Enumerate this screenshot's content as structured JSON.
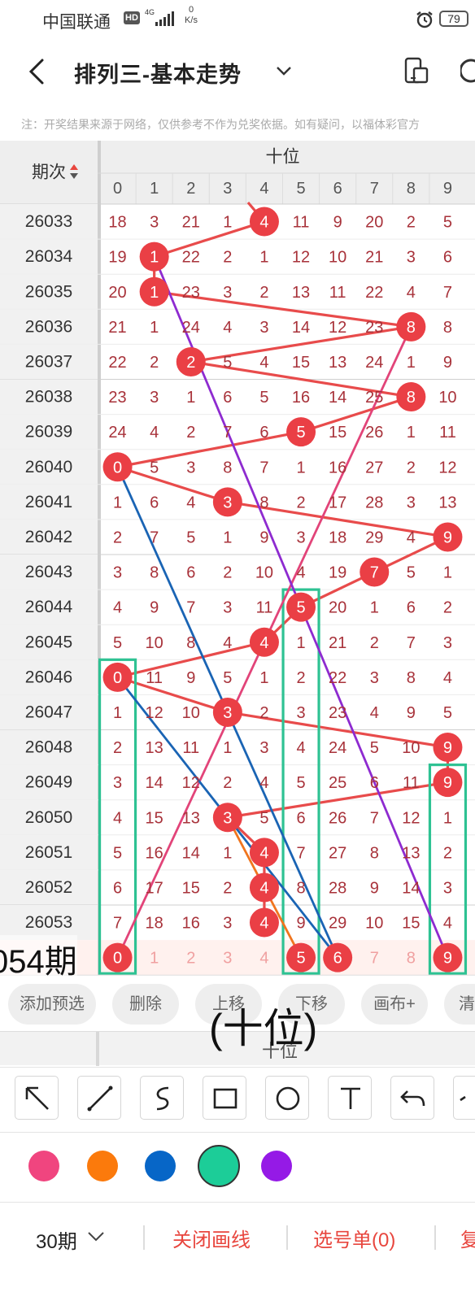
{
  "status_bar": {
    "carrier": "中国联通",
    "hd": "HD",
    "network": "4G",
    "speed_value": "0",
    "speed_unit": "K/s",
    "battery": "79"
  },
  "nav": {
    "title": "排列三-基本走势"
  },
  "notice": "注：开奖结果来源于网络，仅供参考不作为兑奖依据。如有疑问，以福体彩官方",
  "table": {
    "period_header": "期次",
    "group_header": "十位",
    "digits": [
      "0",
      "1",
      "2",
      "3",
      "4",
      "5",
      "6",
      "7",
      "8",
      "9"
    ],
    "rows": [
      {
        "issue": "26033",
        "cells": [
          18,
          3,
          21,
          1,
          4,
          11,
          9,
          20,
          2,
          5
        ],
        "hit": 4
      },
      {
        "issue": "26034",
        "cells": [
          19,
          1,
          22,
          2,
          1,
          12,
          10,
          21,
          3,
          6
        ],
        "hit": 1
      },
      {
        "issue": "26035",
        "cells": [
          20,
          1,
          23,
          3,
          2,
          13,
          11,
          22,
          4,
          7
        ],
        "hit": 1
      },
      {
        "issue": "26036",
        "cells": [
          21,
          1,
          24,
          4,
          3,
          14,
          12,
          23,
          8,
          8
        ],
        "hit": 8
      },
      {
        "issue": "26037",
        "cells": [
          22,
          2,
          2,
          5,
          4,
          15,
          13,
          24,
          1,
          9
        ],
        "hit": 2
      },
      {
        "issue": "26038",
        "cells": [
          23,
          3,
          1,
          6,
          5,
          16,
          14,
          25,
          8,
          10
        ],
        "hit": 8
      },
      {
        "issue": "26039",
        "cells": [
          24,
          4,
          2,
          7,
          6,
          5,
          15,
          26,
          1,
          11
        ],
        "hit": 5
      },
      {
        "issue": "26040",
        "cells": [
          0,
          5,
          3,
          8,
          7,
          1,
          16,
          27,
          2,
          12
        ],
        "hit": 0
      },
      {
        "issue": "26041",
        "cells": [
          1,
          6,
          4,
          3,
          8,
          2,
          17,
          28,
          3,
          13
        ],
        "hit": 3
      },
      {
        "issue": "26042",
        "cells": [
          2,
          7,
          5,
          1,
          9,
          3,
          18,
          29,
          4,
          9
        ],
        "hit": 9
      },
      {
        "issue": "26043",
        "cells": [
          3,
          8,
          6,
          2,
          10,
          4,
          19,
          7,
          5,
          1
        ],
        "hit": 7
      },
      {
        "issue": "26044",
        "cells": [
          4,
          9,
          7,
          3,
          11,
          5,
          20,
          1,
          6,
          2
        ],
        "hit": 5
      },
      {
        "issue": "26045",
        "cells": [
          5,
          10,
          8,
          4,
          4,
          1,
          21,
          2,
          7,
          3
        ],
        "hit": 4
      },
      {
        "issue": "26046",
        "cells": [
          0,
          11,
          9,
          5,
          1,
          2,
          22,
          3,
          8,
          4
        ],
        "hit": 0
      },
      {
        "issue": "26047",
        "cells": [
          1,
          12,
          10,
          3,
          2,
          3,
          23,
          4,
          9,
          5
        ],
        "hit": 3
      },
      {
        "issue": "26048",
        "cells": [
          2,
          13,
          11,
          1,
          3,
          4,
          24,
          5,
          10,
          9
        ],
        "hit": 9
      },
      {
        "issue": "26049",
        "cells": [
          3,
          14,
          12,
          2,
          4,
          5,
          25,
          6,
          11,
          9
        ],
        "hit": 9
      },
      {
        "issue": "26050",
        "cells": [
          4,
          15,
          13,
          3,
          5,
          6,
          26,
          7,
          12,
          1
        ],
        "hit": 3
      },
      {
        "issue": "26051",
        "cells": [
          5,
          16,
          14,
          1,
          4,
          7,
          27,
          8,
          13,
          2
        ],
        "hit": 4
      },
      {
        "issue": "26052",
        "cells": [
          6,
          17,
          15,
          2,
          4,
          8,
          28,
          9,
          14,
          3
        ],
        "hit": 4
      },
      {
        "issue": "26053",
        "cells": [
          7,
          18,
          16,
          3,
          4,
          9,
          29,
          10,
          15,
          4
        ],
        "hit": 4
      }
    ],
    "preview_row": {
      "cells": [
        "0",
        "1",
        "2",
        "3",
        "4",
        "5",
        "6",
        "7",
        "8",
        "9"
      ],
      "selected": [
        0,
        5,
        6,
        9
      ]
    },
    "footer_label": "十位"
  },
  "overlays": {
    "issue_caption": "054期",
    "position_caption": "(十位)"
  },
  "actions": [
    "添加预选",
    "删除",
    "上移",
    "下移",
    "画布+",
    "清"
  ],
  "tools": [
    "arrow-tool",
    "line-tool",
    "curve-tool",
    "rectangle-tool",
    "circle-tool",
    "text-tool",
    "undo-tool"
  ],
  "palette": [
    {
      "name": "pink",
      "hex": "#f0457f"
    },
    {
      "name": "orange",
      "hex": "#fb7a0c"
    },
    {
      "name": "blue",
      "hex": "#0766c7"
    },
    {
      "name": "green",
      "hex": "#1ccd98",
      "selected": true
    },
    {
      "name": "purple",
      "hex": "#951ae6"
    }
  ],
  "footer": {
    "period": "30期",
    "close_lines": "关闭画线",
    "selection": "选号单(0)",
    "more": "复"
  },
  "drawings": {
    "pink_line": {
      "color": "#e24479",
      "from": {
        "row": 21,
        "digit": 0
      },
      "to": {
        "row": 3,
        "digit": 8
      }
    },
    "orange_line": {
      "color": "#f0751e",
      "from": {
        "row": 17,
        "digit": 3
      },
      "to": {
        "row": 21,
        "digit": 5
      }
    },
    "blue_lines": {
      "color": "#1a64b4",
      "segments": [
        [
          {
            "row": 7,
            "digit": 0
          },
          {
            "row": 21,
            "digit": 6
          }
        ],
        [
          {
            "row": 13,
            "digit": 0
          },
          {
            "row": 21,
            "digit": 6
          }
        ]
      ]
    },
    "purple_line": {
      "color": "#8e2bd0",
      "from": {
        "row": 1,
        "digit": 1
      },
      "to": {
        "row": 21,
        "digit": 9
      }
    },
    "green_boxes": {
      "color": "#2ec293",
      "boxes": [
        {
          "digit": 0,
          "from_row": 13,
          "to_row": 21
        },
        {
          "digit": 5,
          "from_row": 11,
          "to_row": 21
        },
        {
          "digit": 9,
          "from_row": 16,
          "to_row": 21
        }
      ]
    }
  }
}
